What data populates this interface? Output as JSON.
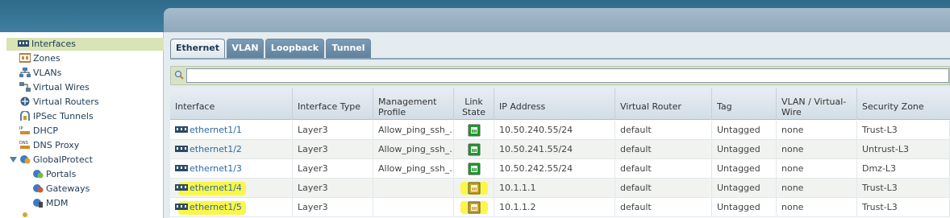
{
  "sidebar": {
    "items": [
      {
        "label": "Interfaces",
        "icon": "interfaces-icon"
      },
      {
        "label": "Zones",
        "icon": "zones-icon"
      },
      {
        "label": "VLANs",
        "icon": "vlans-icon"
      },
      {
        "label": "Virtual Wires",
        "icon": "virtual-wires-icon"
      },
      {
        "label": "Virtual Routers",
        "icon": "virtual-routers-icon"
      },
      {
        "label": "IPSec Tunnels",
        "icon": "ipsec-tunnels-icon"
      },
      {
        "label": "DHCP",
        "icon": "dhcp-icon"
      },
      {
        "label": "DNS Proxy",
        "icon": "dns-proxy-icon"
      },
      {
        "label": "GlobalProtect",
        "icon": "globalprotect-icon"
      },
      {
        "label": "Portals",
        "icon": "portals-icon"
      },
      {
        "label": "Gateways",
        "icon": "gateways-icon"
      },
      {
        "label": "MDM",
        "icon": "mdm-icon"
      }
    ]
  },
  "tabs": [
    {
      "label": "Ethernet"
    },
    {
      "label": "VLAN"
    },
    {
      "label": "Loopback"
    },
    {
      "label": "Tunnel"
    }
  ],
  "search": {
    "value": ""
  },
  "table": {
    "headers": {
      "interface": "Interface",
      "type": "Interface Type",
      "mgmt": "Management Profile",
      "link": "Link State",
      "ip": "IP Address",
      "vr": "Virtual Router",
      "tag": "Tag",
      "vlan": "VLAN / Virtual-Wire",
      "zone": "Security Zone"
    },
    "rows": [
      {
        "interface": "ethernet1/1",
        "type": "Layer3",
        "mgmt": "Allow_ping_ssh_...",
        "link_state": "up",
        "ip": "10.50.240.55/24",
        "vr": "default",
        "tag": "Untagged",
        "vlan": "none",
        "zone": "Trust-L3",
        "highlighted": false
      },
      {
        "interface": "ethernet1/2",
        "type": "Layer3",
        "mgmt": "Allow_ping_ssh_...",
        "link_state": "up",
        "ip": "10.50.241.55/24",
        "vr": "default",
        "tag": "Untagged",
        "vlan": "none",
        "zone": "Untrust-L3",
        "highlighted": false
      },
      {
        "interface": "ethernet1/3",
        "type": "Layer3",
        "mgmt": "Allow_ping_ssh_...",
        "link_state": "up",
        "ip": "10.50.242.55/24",
        "vr": "default",
        "tag": "Untagged",
        "vlan": "none",
        "zone": "Dmz-L3",
        "highlighted": false
      },
      {
        "interface": "ethernet1/4",
        "type": "Layer3",
        "mgmt": "",
        "link_state": "unknown",
        "ip": "10.1.1.1",
        "vr": "default",
        "tag": "Untagged",
        "vlan": "none",
        "zone": "Trust-L3",
        "highlighted": true
      },
      {
        "interface": "ethernet1/5",
        "type": "Layer3",
        "mgmt": "",
        "link_state": "unknown",
        "ip": "10.1.1.2",
        "vr": "default",
        "tag": "Untagged",
        "vlan": "none",
        "zone": "Trust-L3",
        "highlighted": true
      }
    ]
  },
  "colors": {
    "selected_bg": "#d8e4b5",
    "link_up": "#1a9a2a",
    "link_unknown": "#c9a11c",
    "highlight": "#fbf64a",
    "link_text": "#2b6aa3"
  }
}
